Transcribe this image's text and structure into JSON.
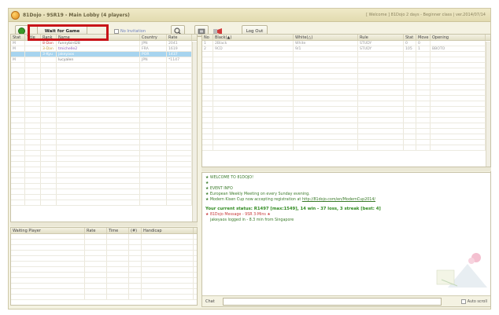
{
  "title": "81Dojo - 9SR19 - Main Lobby (4 players)",
  "title_right": "[ Welcome ] 81Dojo 2 days - Beginner class  |  ver.2014/07/14",
  "toolbar": {
    "lfg_label": "Wait for Game",
    "no_invitation_label": "No Invitation",
    "logout_label": "Log Out"
  },
  "players_panel": {
    "headers": [
      "Stat",
      "Title",
      "Rank",
      "Name",
      "Country",
      "Rate"
    ],
    "rows": [
      {
        "stat": "M",
        "title": "",
        "rank": "8-Dan",
        "name": "funnybird28",
        "country": "JPN",
        "rate": "2041",
        "selected": false
      },
      {
        "stat": "M",
        "title": "",
        "rank": "3-Dan",
        "name": "tmichelle2",
        "country": "FRA",
        "rate": "1619",
        "selected": false
      },
      {
        "stat": "",
        "title": "",
        "rank": "3-Kyu",
        "name": "jakeyaos",
        "country": "POR",
        "rate": "1437",
        "selected": true
      },
      {
        "stat": "M",
        "title": "",
        "rank": "",
        "name": "lucyalen",
        "country": "JPN",
        "rate": "*1147",
        "selected": false
      }
    ]
  },
  "games_panel": {
    "headers": [
      "No",
      "Black(▲)",
      "White(△)",
      "Rule",
      "Stat",
      "Move",
      "Opening"
    ],
    "rows": [
      {
        "no": "1",
        "black": "2Black",
        "white": "White",
        "rule": "STUDY",
        "stat": "0",
        "move": "0",
        "opening": ""
      },
      {
        "no": "2",
        "black": "9CD",
        "white": "9/1",
        "rule": "STUDY",
        "stat": "105",
        "move": "1",
        "opening": "BBOTO"
      }
    ]
  },
  "waiting_panel": {
    "headers": [
      "Waiting Player",
      "Rate",
      "Time",
      "(#)",
      "Handicap"
    ]
  },
  "chat": {
    "lines": [
      {
        "text": "★ WELCOME TO 81DOJO!",
        "class": "c-green"
      },
      {
        "text": "★",
        "class": "c-green"
      },
      {
        "text": "★ EVENT INFO",
        "class": "c-green"
      },
      {
        "text": "★ European Weekly Meeting on every Sunday evening.",
        "class": "c-green"
      },
      {
        "text": "★ Modern Kisen Cup now accepting registration at ",
        "class": "c-green",
        "link": "http://81dojo.com/en/ModernCup2014/"
      }
    ],
    "status_text": "Your current status: R1497 [max:1549], 14 win - 37 loss, 3 streak [best: 4]",
    "notice_text": "★ 81Dojo Message - 9SR 3-Mins ★",
    "notice_sub": "jakeyaos logged in - 8.3 min from Singapore",
    "chat_label": "Chat",
    "autoscroll_label": "Auto scroll"
  }
}
